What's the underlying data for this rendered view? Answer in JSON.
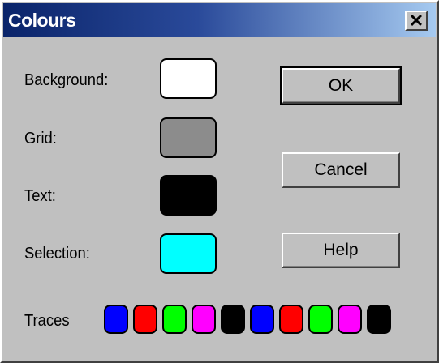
{
  "window": {
    "title": "Colours",
    "close_glyph": "✕"
  },
  "labels": {
    "background": "Background:",
    "grid": "Grid:",
    "text": "Text:",
    "selection": "Selection:",
    "traces": "Traces"
  },
  "colors": {
    "background": "#ffffff",
    "grid": "#8c8c8c",
    "text": "#000000",
    "selection": "#00ffff",
    "traces": [
      "#0000ff",
      "#ff0000",
      "#00ff00",
      "#ff00ff",
      "#000000",
      "#0000ff",
      "#ff0000",
      "#00ff00",
      "#ff00ff",
      "#000000"
    ]
  },
  "buttons": {
    "ok": "OK",
    "cancel": "Cancel",
    "help": "Help"
  }
}
